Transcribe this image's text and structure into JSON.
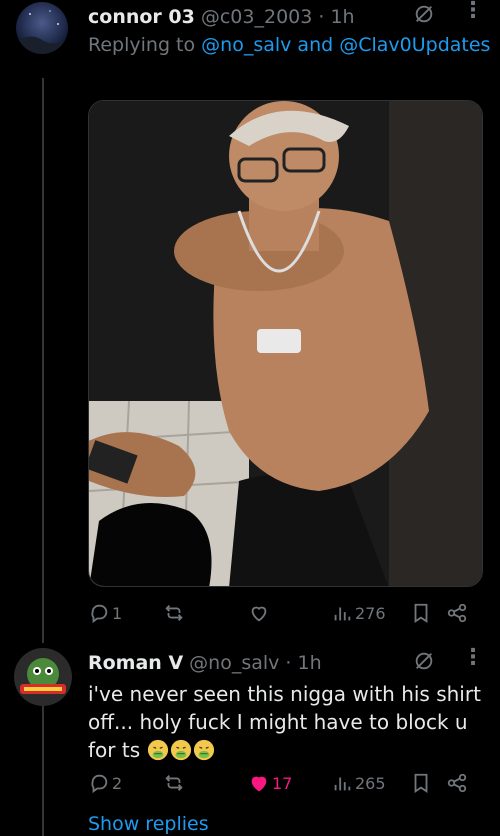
{
  "tweet1": {
    "name": "connor 03",
    "handle": "@c03_2003 · 1h",
    "replying_prefix": "Replying to ",
    "replying_users": "@no_salv and @Clav0Updates",
    "stats": {
      "replies": "1",
      "retweets": "",
      "likes": "",
      "views": "276"
    }
  },
  "tweet2": {
    "name": "Roman V",
    "handle": "@no_salv · 1h",
    "text": "i've never seen this nigga with his shirt off... holy fuck I might have to block u for ts",
    "stats": {
      "replies": "2",
      "retweets": "",
      "likes": "17",
      "views": "265"
    }
  },
  "show_replies": "Show replies",
  "colors": {
    "accent": "#1d9bf0",
    "like": "#f91880",
    "muted": "#71767b"
  },
  "icons": [
    "reply-icon",
    "retweet-icon",
    "like-icon",
    "views-icon",
    "bookmark-icon",
    "share-icon",
    "grok-icon",
    "more-icon",
    "nauseated-face-emoji"
  ]
}
